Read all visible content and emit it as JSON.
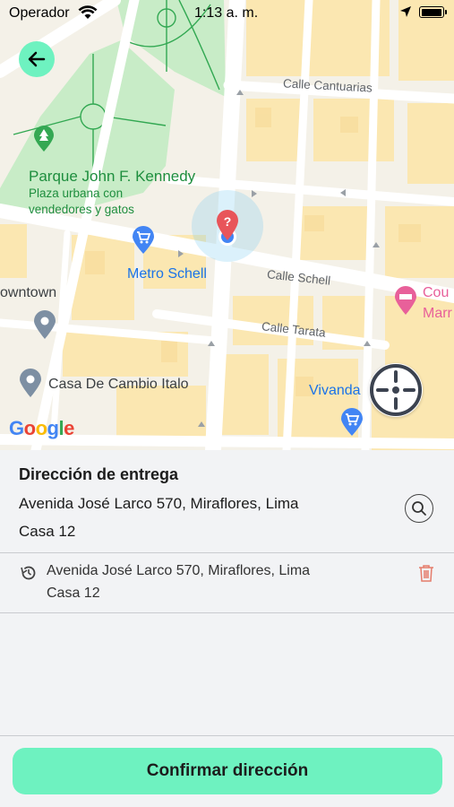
{
  "status_bar": {
    "carrier": "Operador",
    "time": "1:13 a. m.",
    "battery_level": 1.0
  },
  "map": {
    "labels": {
      "calle_cantuarias": "Calle Cantuarias",
      "park_name": "Parque John F. Kennedy",
      "park_desc_1": "Plaza urbana con",
      "park_desc_2": "vendedores y gatos",
      "metro_schell": "Metro Schell",
      "calle_schell": "Calle Schell",
      "downtown": "owntown",
      "calle_tarata": "Calle Tarata",
      "casa_cambio": "Casa De Cambio Italo",
      "vivanda": "Vivanda",
      "cour_1": "Cou",
      "cour_2": "Marr"
    },
    "google_logo": "Google",
    "colors": {
      "park": "#c8ecc7",
      "building": "#fbe7b1",
      "road": "#ffffff",
      "pin": "#e8555a",
      "accent": "#6ef2c0"
    }
  },
  "delivery": {
    "title": "Dirección de entrega",
    "address_line1": "Avenida José Larco 570, Miraflores, Lima",
    "address_line2": "Casa 12"
  },
  "history": [
    {
      "line1": "Avenida José Larco 570, Miraflores, Lima",
      "line2": "Casa 12"
    }
  ],
  "confirm_label": "Confirmar dirección"
}
